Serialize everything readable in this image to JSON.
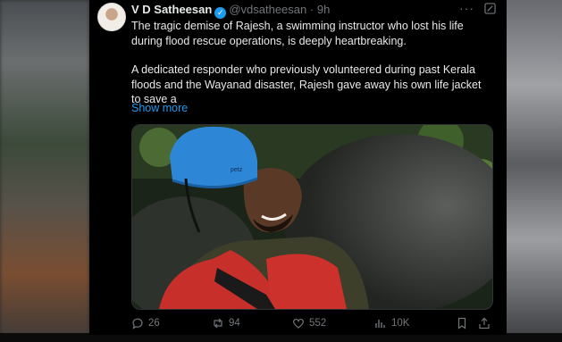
{
  "post": {
    "author_name": "V D Satheesan",
    "verified_icon": "verified-badge-icon",
    "handle": "@vdsatheesan",
    "separator": "·",
    "time": "9h",
    "paragraph_1": "The tragic demise of Rajesh, a swimming instructor who lost his life during flood rescue operations, is deeply heartbreaking.",
    "paragraph_2": "A dedicated responder who previously volunteered during past Kerala floods and the Wayanad disaster, Rajesh gave away his own life jacket to save a",
    "show_more": "Show more",
    "helmet_text": "petz"
  },
  "actions": {
    "replies": "26",
    "reposts": "94",
    "likes": "552",
    "views": "10K"
  },
  "colors": {
    "link": "#1d9bf0",
    "muted": "#71767b",
    "background": "#000000",
    "text": "#e7e9ea"
  }
}
